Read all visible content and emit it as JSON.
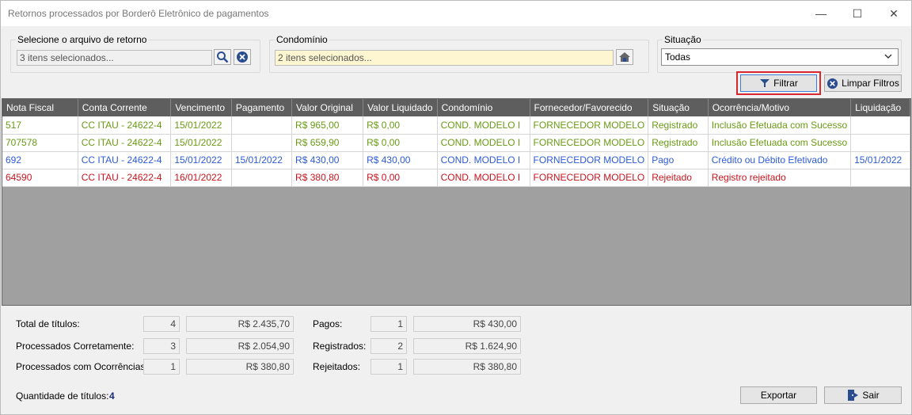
{
  "window": {
    "title": "Retornos processados por Borderô Eletrônico de pagamentos",
    "minimize": "—",
    "maximize": "☐",
    "close": "✕"
  },
  "filters": {
    "arquivo_label": "Selecione o arquivo de retorno",
    "arquivo_value": "3 itens selecionados...",
    "condominio_label": "Condomínio",
    "condominio_value": "2 itens selecionados...",
    "situacao_label": "Situação",
    "situacao_value": "Todas",
    "filtrar_label": "Filtrar",
    "limpar_label": "Limpar Filtros"
  },
  "table": {
    "columns": [
      "Nota Fiscal",
      "Conta Corrente",
      "Vencimento",
      "Pagamento",
      "Valor Original",
      "Valor Liquidado",
      "Condomínio",
      "Fornecedor/Favorecido",
      "Situação",
      "Ocorrência/Motivo",
      "Liquidação"
    ],
    "rows": [
      {
        "status": "registrado",
        "cells": [
          "517",
          "CC ITAU - 24622-4",
          "15/01/2022",
          "",
          "R$ 965,00",
          "R$ 0,00",
          "COND. MODELO I",
          "FORNECEDOR MODELO",
          "Registrado",
          "Inclusão Efetuada com Sucesso",
          ""
        ]
      },
      {
        "status": "registrado",
        "cells": [
          "707578",
          "CC ITAU - 24622-4",
          "15/01/2022",
          "",
          "R$ 659,90",
          "R$ 0,00",
          "COND. MODELO I",
          "FORNECEDOR MODELO",
          "Registrado",
          "Inclusão Efetuada com Sucesso",
          ""
        ]
      },
      {
        "status": "pago",
        "cells": [
          "692",
          "CC ITAU - 24622-4",
          "15/01/2022",
          "15/01/2022",
          "R$ 430,00",
          "R$ 430,00",
          "COND. MODELO I",
          "FORNECEDOR MODELO",
          "Pago",
          "Crédito ou Débito Efetivado",
          "15/01/2022"
        ]
      },
      {
        "status": "rejeitado",
        "cells": [
          "64590",
          "CC ITAU - 24622-4",
          "16/01/2022",
          "",
          "R$ 380,80",
          "R$ 0,00",
          "COND. MODELO I",
          "FORNECEDOR MODELO",
          "Rejeitado",
          "Registro rejeitado",
          ""
        ]
      }
    ]
  },
  "summary": {
    "total_label": "Total de títulos:",
    "total_count": "4",
    "total_value": "R$ 2.435,70",
    "corretos_label": "Processados Corretamente:",
    "corretos_count": "3",
    "corretos_value": "R$ 2.054,90",
    "ocorrencias_label": "Processados com Ocorrências:",
    "ocorrencias_count": "1",
    "ocorrencias_value": "R$ 380,80",
    "pagos_label": "Pagos:",
    "pagos_count": "1",
    "pagos_value": "R$ 430,00",
    "registrados_label": "Registrados:",
    "registrados_count": "2",
    "registrados_value": "R$ 1.624,90",
    "rejeitados_label": "Rejeitados:",
    "rejeitados_count": "1",
    "rejeitados_value": "R$ 380,80",
    "quantidade_label": "Quantidade de títulos:",
    "quantidade_value": "4"
  },
  "footer": {
    "exportar_label": "Exportar",
    "sair_label": "Sair"
  },
  "colors": {
    "registrado": "#6a9a14",
    "pago": "#2d5bd8",
    "rejeitado": "#c8141e",
    "highlight": "#d9262f"
  }
}
